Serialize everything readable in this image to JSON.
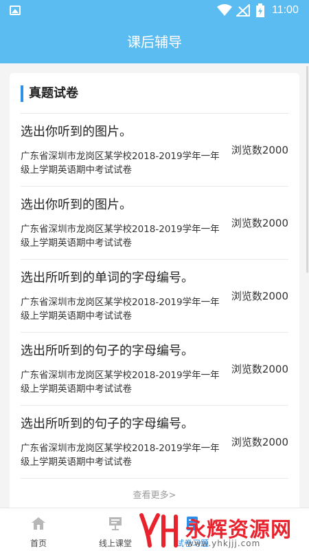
{
  "status": {
    "time": "11:00"
  },
  "header": {
    "title": "课后辅导"
  },
  "section": {
    "title": "真题试卷"
  },
  "items": [
    {
      "question": "选出你听到的图片。",
      "source": "广东省深圳市龙岗区某学校2018-2019学年一年级上学期英语期中考试试卷",
      "views": "浏览数2000"
    },
    {
      "question": "选出你听到的图片。",
      "source": "广东省深圳市龙岗区某学校2018-2019学年一年级上学期英语期中考试试卷",
      "views": "浏览数2000"
    },
    {
      "question": "选出所听到的单词的字母编号。",
      "source": "广东省深圳市龙岗区某学校2018-2019学年一年级上学期英语期中考试试卷",
      "views": "浏览数2000"
    },
    {
      "question": "选出所听到的句子的字母编号。",
      "source": "广东省深圳市龙岗区某学校2018-2019学年一年级上学期英语期中考试试卷",
      "views": "浏览数2000"
    },
    {
      "question": "选出所听到的句子的字母编号。",
      "source": "广东省深圳市龙岗区某学校2018-2019学年一年级上学期英语期中考试试卷",
      "views": "浏览数2000"
    }
  ],
  "more_label": "查看更多>",
  "tabs": [
    {
      "label": "首页",
      "icon": "home-icon"
    },
    {
      "label": "线上课堂",
      "icon": "classroom-icon"
    },
    {
      "label": "试卷习题",
      "icon": "exam-icon",
      "active": true
    }
  ],
  "watermark": {
    "brand": "永辉资源网",
    "url": "www.yhkjjj.com"
  },
  "colors": {
    "primary": "#5bbcf2",
    "accent": "#2e8fe8",
    "watermark": "#e8232e"
  }
}
